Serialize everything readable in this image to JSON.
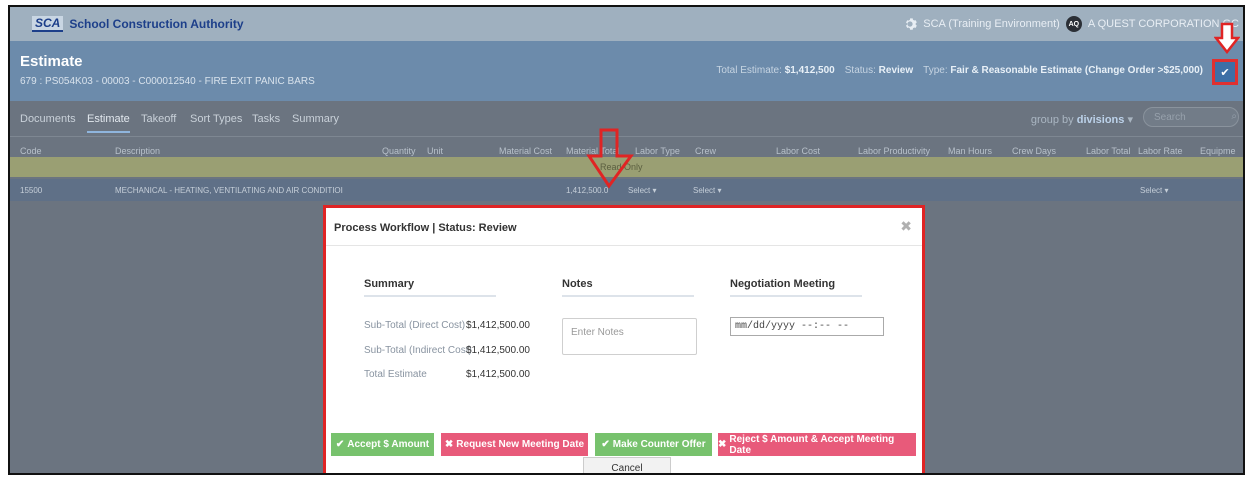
{
  "topbar": {
    "logo_badge": "SCA",
    "logo_text": "School Construction Authority",
    "environment": "SCA (Training Environment)",
    "user_initials": "AQ",
    "user_name": "A QUEST CORPORATION GC"
  },
  "header": {
    "title": "Estimate",
    "subtitle": "679 : PS054K03 - 00003 - C000012540 - FIRE EXIT PANIC BARS",
    "total_label": "Total Estimate:",
    "total_value": "$1,412,500",
    "status_label": "Status:",
    "status_value": "Review",
    "type_label": "Type:",
    "type_value": "Fair & Reasonable Estimate (Change Order >$25,000)"
  },
  "tabs": [
    "Documents",
    "Estimate",
    "Takeoff",
    "Sort Types",
    "Tasks",
    "Summary"
  ],
  "group_by": {
    "label": "group by",
    "value": "divisions"
  },
  "search": {
    "placeholder": "Search"
  },
  "table": {
    "headers": [
      "Code",
      "Description",
      "Quantity",
      "Unit",
      "Material Cost",
      "Material Total",
      "Labor Type",
      "Crew",
      "Labor Cost",
      "Labor Productivity",
      "Man Hours",
      "Crew Days",
      "Labor Total",
      "Labor Rate",
      "Equipme"
    ],
    "readonly_text": "Read Only",
    "row": {
      "code": "15500",
      "description": "MECHANICAL - HEATING, VENTILATING AND AIR CONDITIOI",
      "material_total": "1,412,500.0",
      "labor_type": "Select",
      "crew": "Select",
      "labor_rate": "Select"
    }
  },
  "modal": {
    "title": "Process Workflow | Status: Review",
    "summary_heading": "Summary",
    "notes_heading": "Notes",
    "meeting_heading": "Negotiation Meeting",
    "subtotal_direct_label": "Sub-Total (Direct Cost)",
    "subtotal_direct_value": "$1,412,500.00",
    "subtotal_indirect_label": "Sub-Total (Indirect Cost)",
    "subtotal_indirect_value": "$1,412,500.00",
    "total_label": "Total Estimate",
    "total_value": "$1,412,500.00",
    "notes_placeholder": "Enter Notes",
    "date_placeholder": "mm/dd/yyyy --:-- --",
    "accept_label": "Accept $ Amount",
    "request_label": "Request New Meeting Date",
    "counter_label": "Make Counter Offer",
    "reject_label": "Reject $ Amount & Accept Meeting Date",
    "cancel_label": "Cancel"
  },
  "colors": {
    "accent_red": "#e02424",
    "green": "#77c26d",
    "pink": "#e85a7a"
  }
}
